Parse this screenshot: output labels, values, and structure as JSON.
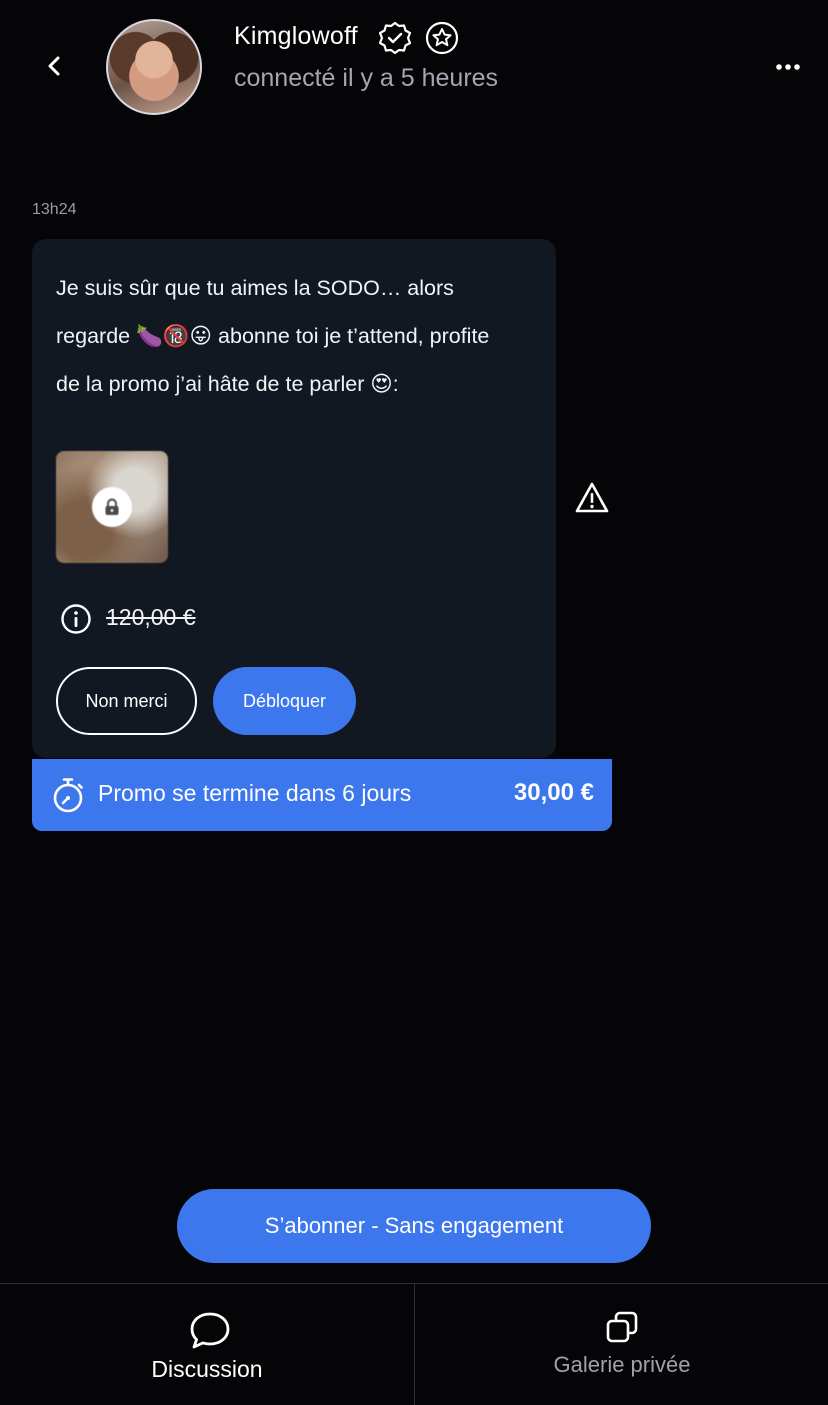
{
  "header": {
    "username": "Kimglowoff",
    "status": "connecté il y a 5 heures",
    "icons": [
      "chevron-left-icon",
      "verified-badge-icon",
      "star-badge-icon",
      "more-dots-icon"
    ]
  },
  "message": {
    "time": "13h24",
    "line1": "Je suis sûr que tu aimes la SODO… alors",
    "line2_before": "regarde ",
    "emoji1": "🍆",
    "emoji2": "🔞",
    "emoji3": "😛",
    "line2_after": " abonne toi je t’attend, profite",
    "line3_before": "de la promo j’ai hâte de te parler ",
    "emoji4": "😍",
    "line3_after": ":",
    "original_price": "120,00 €",
    "decline_label": "Non merci",
    "unlock_label": "Débloquer",
    "media_locked": true
  },
  "promo": {
    "text": "Promo se termine dans 6 jours",
    "price": "30,00 €"
  },
  "subscribe": {
    "label": "S’abonner - Sans engagement"
  },
  "nav": {
    "tabs": [
      {
        "label": "Discussion",
        "active": true
      },
      {
        "label": "Galerie privée",
        "active": false
      }
    ]
  },
  "colors": {
    "background": "#050508",
    "card": "#121821",
    "accent": "#3d77ee",
    "muted": "#a4a7b0"
  }
}
